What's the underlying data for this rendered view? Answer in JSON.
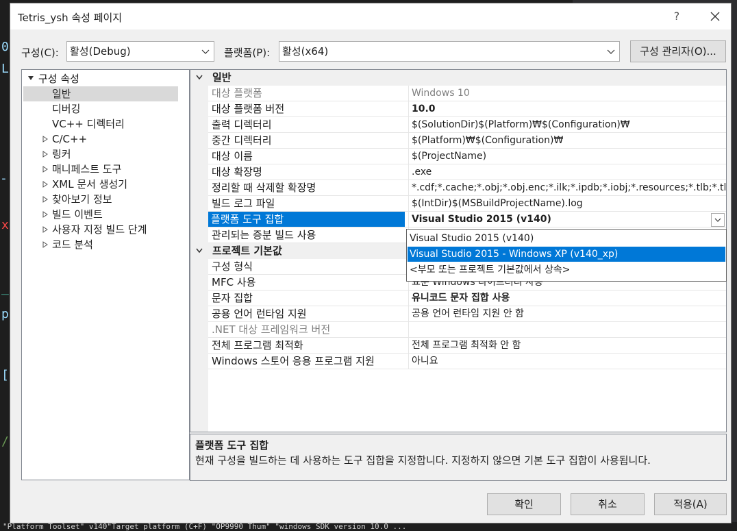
{
  "window": {
    "title": "Tetris_ysh 속성 페이지",
    "help_label": "?"
  },
  "toolbar": {
    "config_label": "구성(C):",
    "config_value": "활성(Debug)",
    "platform_label": "플랫폼(P):",
    "platform_value": "활성(x64)",
    "config_manager_label": "구성 관리자(O)..."
  },
  "tree": {
    "root": "구성 속성",
    "items": [
      {
        "label": "일반",
        "expandable": false,
        "selected": true
      },
      {
        "label": "디버깅",
        "expandable": false
      },
      {
        "label": "VC++ 디렉터리",
        "expandable": false
      },
      {
        "label": "C/C++",
        "expandable": true
      },
      {
        "label": "링커",
        "expandable": true
      },
      {
        "label": "매니페스트 도구",
        "expandable": true
      },
      {
        "label": "XML 문서 생성기",
        "expandable": true
      },
      {
        "label": "찾아보기 정보",
        "expandable": true
      },
      {
        "label": "빌드 이벤트",
        "expandable": true
      },
      {
        "label": "사용자 지정 빌드 단계",
        "expandable": true
      },
      {
        "label": "코드 분석",
        "expandable": true
      }
    ]
  },
  "grid": {
    "categories": [
      {
        "label": "일반",
        "rows": [
          {
            "name": "대상 플랫폼",
            "value": "Windows 10",
            "dim": true
          },
          {
            "name": "대상 플랫폼 버전",
            "value": "10.0",
            "bold": true
          },
          {
            "name": "출력 디렉터리",
            "value": "$(SolutionDir)$(Platform)₩$(Configuration)₩"
          },
          {
            "name": "중간 디렉터리",
            "value": "$(Platform)₩$(Configuration)₩"
          },
          {
            "name": "대상 이름",
            "value": "$(ProjectName)"
          },
          {
            "name": "대상 확장명",
            "value": ".exe"
          },
          {
            "name": "정리할 때 삭제할 확장명",
            "value": "*.cdf;*.cache;*.obj;*.obj.enc;*.ilk;*.ipdb;*.iobj;*.resources;*.tlb;*.tli;*.tlh;*.t"
          },
          {
            "name": "빌드 로그 파일",
            "value": "$(IntDir)$(MSBuildProjectName).log"
          },
          {
            "name": "플랫폼 도구 집합",
            "value": "Visual Studio 2015 (v140)",
            "selected": true
          },
          {
            "name": "관리되는 증분 빌드 사용",
            "value": ""
          }
        ]
      },
      {
        "label": "프로젝트 기본값",
        "rows": [
          {
            "name": "구성 형식",
            "value": ""
          },
          {
            "name": "MFC 사용",
            "value": "표준 Windows 라이브러리 사용"
          },
          {
            "name": "문자 집합",
            "value": "유니코드 문자 집합 사용",
            "bold": true
          },
          {
            "name": "공용 언어 런타임 지원",
            "value": "공용 언어 런타임 지원 안 함"
          },
          {
            "name": ".NET 대상 프레임워크 버전",
            "value": "",
            "dim": true
          },
          {
            "name": "전체 프로그램 최적화",
            "value": "전체 프로그램 최적화 안 함"
          },
          {
            "name": "Windows 스토어 응용 프로그램 지원",
            "value": "아니요"
          }
        ]
      }
    ]
  },
  "dropdown": {
    "options": [
      {
        "label": "Visual Studio 2015 (v140)"
      },
      {
        "label": "Visual Studio 2015 - Windows XP (v140_xp)",
        "highlighted": true
      },
      {
        "label": "<부모 또는 프로젝트 기본값에서 상속>"
      }
    ]
  },
  "description": {
    "title": "플랫폼 도구 집합",
    "text": "현재 구성을 빌드하는 데 사용하는 도구 집합을 지정합니다. 지정하지 않으면 기본 도구 집합이 사용됩니다."
  },
  "buttons": {
    "ok": "확인",
    "cancel": "취소",
    "apply": "적용(A)"
  },
  "background": {
    "editor_chars": [
      "0",
      "L",
      "-)",
      "x",
      "_H",
      "pa",
      "[[",
      "//"
    ],
    "bottom_line": "\"Platform Toolset\" v140\"Target platform (C+F)      \"OP9990  Thum\"  \"windows SDK version 10.0 ...  "
  }
}
